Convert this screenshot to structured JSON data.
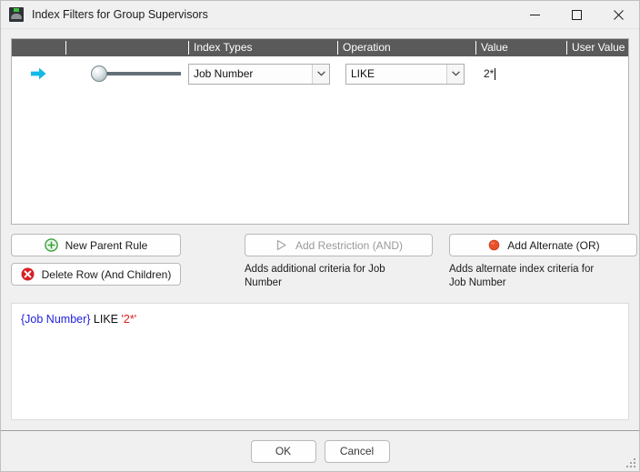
{
  "window": {
    "title": "Index Filters for Group Supervisors",
    "icon": "app-icon",
    "controls": {
      "minimize": "minimize-icon",
      "maximize": "maximize-icon",
      "close": "close-icon"
    }
  },
  "grid": {
    "columns": [
      "",
      "",
      "Index Types",
      "Operation",
      "Value",
      "User Value"
    ],
    "rows": [
      {
        "marker": "right-arrow-icon",
        "node": "tree-node-handle",
        "index_type": "Job Number",
        "operation": "LIKE",
        "value": "2*",
        "user_value": ""
      }
    ]
  },
  "actions": {
    "new_parent_rule": "New Parent Rule",
    "delete_row": "Delete Row (And Children)",
    "add_restriction": "Add Restriction (AND)",
    "add_alternate": "Add Alternate (OR)",
    "hint_restriction": "Adds additional criteria for Job Number",
    "hint_alternate": "Adds alternate index criteria for Job Number"
  },
  "expression": {
    "field": "{Job Number}",
    "operator": "LIKE",
    "value": "'2*'"
  },
  "footer": {
    "ok": "OK",
    "cancel": "Cancel"
  },
  "colors": {
    "header_bg": "#5a5a5a",
    "marker_arrow": "#12b9e8",
    "add_icon_green": "#3aa03a",
    "delete_icon_red": "#d81f26",
    "alternate_icon_red": "#e8502a",
    "expression_field": "#2222dd",
    "expression_value": "#e01b1b"
  }
}
